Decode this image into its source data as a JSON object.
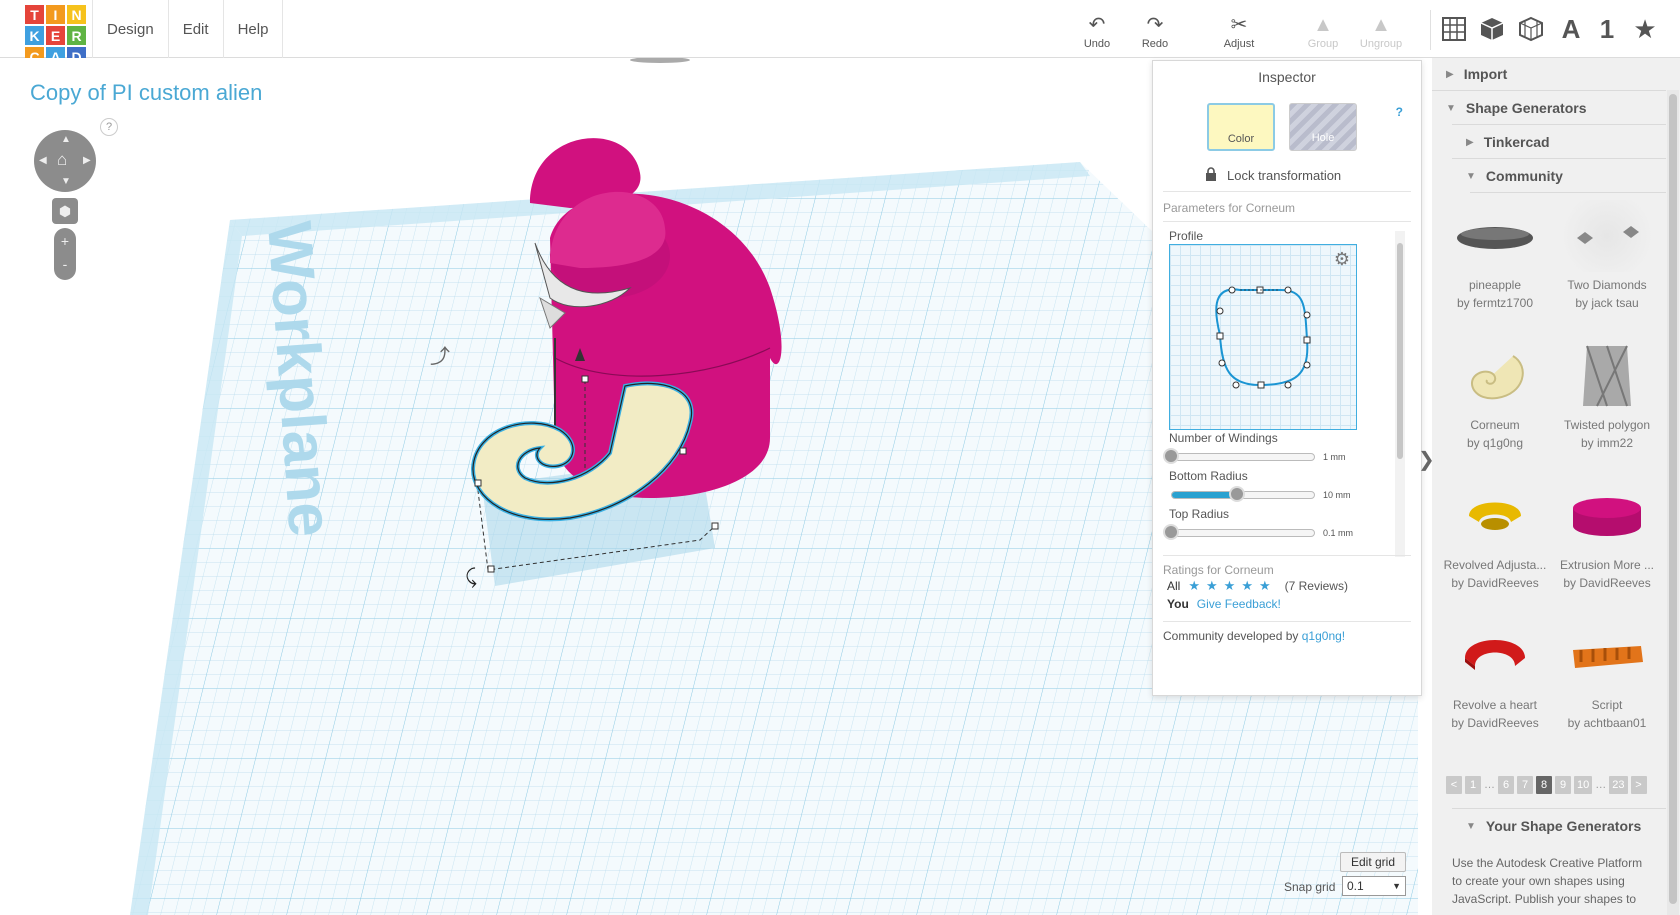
{
  "app": {
    "logo_letters": [
      "T",
      "I",
      "N",
      "K",
      "E",
      "R",
      "C",
      "A",
      "D"
    ],
    "logo_colors": [
      "#e5443a",
      "#f39a1e",
      "#f6c21c",
      "#3fa0e0",
      "#e5443a",
      "#5fb443",
      "#f39a1e",
      "#3fa0e0",
      "#3f6fc7"
    ],
    "menu": [
      "Design",
      "Edit",
      "Help"
    ]
  },
  "toolbar": {
    "undo": "Undo",
    "redo": "Redo",
    "adjust": "Adjust",
    "group": "Group",
    "ungroup": "Ungroup",
    "view_icons": [
      "grid-view-icon",
      "cube-icon",
      "wireframe-icon",
      "text-tool-icon",
      "number-tool-icon",
      "favorites-star-icon"
    ],
    "text_tool_glyph": "A",
    "number_tool_glyph": "1"
  },
  "workspace": {
    "project_title": "Copy of PI custom alien",
    "workplane_label": "Workplane",
    "nav_help": "?",
    "zoom_in": "+",
    "zoom_out": "-"
  },
  "inspector": {
    "title": "Inspector",
    "color_label": "Color",
    "hole_label": "Hole",
    "help": "?",
    "lock_label": "Lock transformation",
    "params_title": "Parameters for Corneum",
    "profile_label": "Profile",
    "params": [
      {
        "label": "Number of Windings",
        "value": "1 mm",
        "level": 0.0
      },
      {
        "label": "Bottom Radius",
        "value": "10 mm",
        "level": 0.46
      },
      {
        "label": "Top Radius",
        "value": "0.1 mm",
        "level": 0.0
      }
    ],
    "ratings_title": "Ratings for Corneum",
    "ratings_all": "All",
    "ratings_stars": 5,
    "ratings_reviews": "(7 Reviews)",
    "ratings_you": "You",
    "give_feedback": "Give Feedback!",
    "community_prefix": "Community developed by ",
    "community_author": "q1g0ng!"
  },
  "sidebar": {
    "import": "Import",
    "shape_generators": "Shape Generators",
    "tinkercad": "Tinkercad",
    "community": "Community",
    "shapes": [
      {
        "name": "pineapple",
        "author": "by fermtz1700"
      },
      {
        "name": "Two Diamonds",
        "author": "by jack tsau"
      },
      {
        "name": "Corneum",
        "author": "by q1g0ng"
      },
      {
        "name": "Twisted polygon",
        "author": "by imm22"
      },
      {
        "name": "Revolved Adjusta...",
        "author": "by DavidReeves"
      },
      {
        "name": "Extrusion More ...",
        "author": "by DavidReeves"
      },
      {
        "name": "Revolve a heart",
        "author": "by DavidReeves"
      },
      {
        "name": "Script",
        "author": "by achtbaan01"
      }
    ],
    "pager": {
      "prev": "<",
      "pages": [
        "1",
        "…",
        "6",
        "7",
        "8",
        "9",
        "10",
        "…",
        "23"
      ],
      "active": "8",
      "next": ">"
    },
    "your_generators": "Your Shape Generators",
    "your_desc": "Use the Autodesk Creative Platform to create your own shapes using JavaScript. Publish your shapes to"
  },
  "grid": {
    "edit_grid": "Edit grid",
    "snap_label": "Snap grid",
    "snap_value": "0.1"
  },
  "colors": {
    "accent": "#3a9fd6",
    "alien_body": "#d1117f",
    "horn": "#f2ecc5",
    "workplane": "#bfe3f2"
  }
}
